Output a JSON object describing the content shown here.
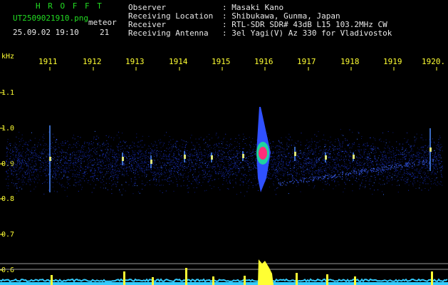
{
  "header": {
    "app_name": "H R O F F T",
    "file_name": "UT2509021910.png",
    "type_label": "meteor",
    "date_time": "25.09.02 19:10",
    "count": "21",
    "fields": [
      {
        "label": "Observer",
        "value": ": Masaki Kano"
      },
      {
        "label": "Receiving Location",
        "value": ": Shibukawa, Gunma, Japan"
      },
      {
        "label": "Receiver",
        "value": ": RTL-SDR SDR# 43dB L15 103.2MHz CW"
      },
      {
        "label": "Receiving Antenna",
        "value": ": 3el Yagi(V) Az 330 for Vladivostok"
      }
    ]
  },
  "axis": {
    "unit": "kHz",
    "time_ticks": [
      "1911",
      "1912",
      "1913",
      "1914",
      "1915",
      "1916",
      "1917",
      "1918",
      "1919",
      "1920."
    ],
    "freq_ticks": [
      "1.1",
      "1.0",
      "0.9",
      "0.8",
      "0.7",
      "0.6"
    ]
  },
  "colors": {
    "background": "#000000",
    "noise": "#1a2fb8",
    "echo": "#ff2d7a",
    "level": "#ffff33",
    "baseline": "#33ccff"
  }
}
